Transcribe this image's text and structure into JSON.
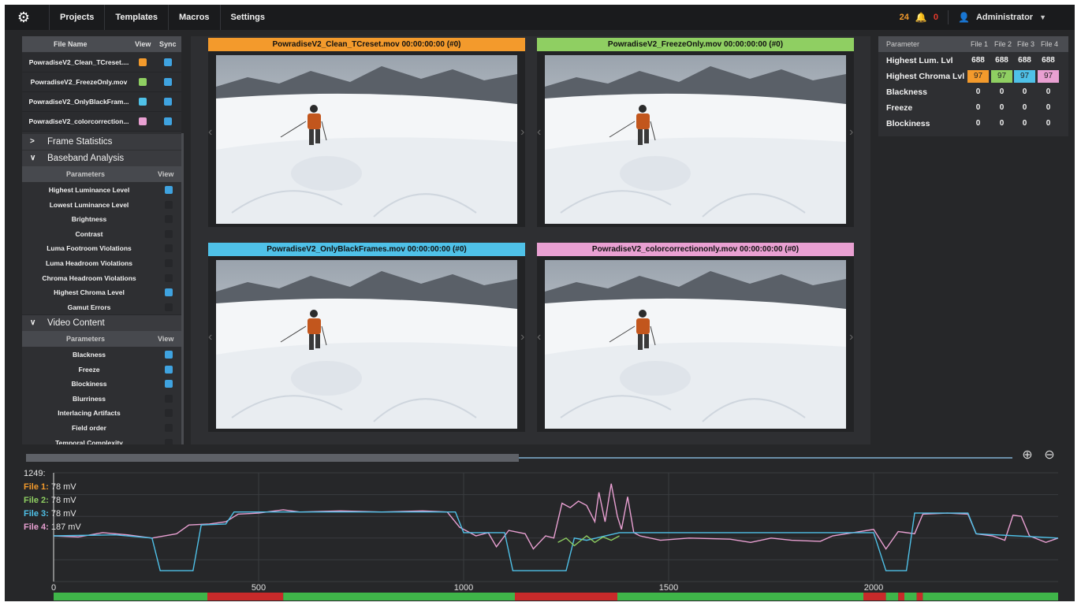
{
  "nav": {
    "items": [
      "Projects",
      "Templates",
      "Macros",
      "Settings"
    ]
  },
  "status": {
    "warnings": "24",
    "alerts": "0",
    "user": "Administrator"
  },
  "files": {
    "headers": {
      "name": "File Name",
      "view": "View",
      "sync": "Sync"
    },
    "rows": [
      {
        "name": "PowradiseV2_Clean_TCreset....",
        "color": "#f39a2c"
      },
      {
        "name": "PowradiseV2_FreezeOnly.mov",
        "color": "#8fcf62"
      },
      {
        "name": "PowradiseV2_OnlyBlackFram...",
        "color": "#4fc1e8"
      },
      {
        "name": "PowradiseV2_colorcorrection...",
        "color": "#e9a0d2"
      }
    ]
  },
  "sections": {
    "frame_stats": "Frame Statistics",
    "baseband": "Baseband Analysis",
    "video": "Video Content"
  },
  "params_headers": {
    "parameters": "Parameters",
    "view": "View"
  },
  "baseband_params": [
    {
      "name": "Highest Luminance Level",
      "on": true
    },
    {
      "name": "Lowest Luminance Level",
      "on": false
    },
    {
      "name": "Brightness",
      "on": false
    },
    {
      "name": "Contrast",
      "on": false
    },
    {
      "name": "Luma Footroom Violations",
      "on": false
    },
    {
      "name": "Luma Headroom Violations",
      "on": false
    },
    {
      "name": "Chroma Headroom Violations",
      "on": false
    },
    {
      "name": "Highest Chroma Level",
      "on": true
    },
    {
      "name": "Gamut Errors",
      "on": false
    }
  ],
  "video_params": [
    {
      "name": "Blackness",
      "on": true
    },
    {
      "name": "Freeze",
      "on": true
    },
    {
      "name": "Blockiness",
      "on": true
    },
    {
      "name": "Blurriness",
      "on": false
    },
    {
      "name": "Interlacing Artifacts",
      "on": false
    },
    {
      "name": "Field order",
      "on": false
    },
    {
      "name": "Temporal Complexity",
      "on": false
    }
  ],
  "videos": [
    {
      "title": "PowradiseV2_Clean_TCreset.mov 00:00:00:00 (#0)",
      "color": "#f39a2c"
    },
    {
      "title": "PowradiseV2_FreezeOnly.mov 00:00:00:00 (#0)",
      "color": "#8fcf62"
    },
    {
      "title": "PowradiseV2_OnlyBlackFrames.mov 00:00:00:00 (#0)",
      "color": "#4fc1e8"
    },
    {
      "title": "PowradiseV2_colorcorrectiononly.mov 00:00:00:00 (#0)",
      "color": "#e9a0d2"
    }
  ],
  "stats": {
    "headers": [
      "Parameter",
      "File 1",
      "File 2",
      "File 3",
      "File 4"
    ],
    "rows": [
      {
        "label": "Highest Lum. Lvl",
        "values": [
          "688",
          "688",
          "688",
          "688"
        ]
      },
      {
        "label": "Highest Chroma Lvl",
        "values": [
          "97",
          "97",
          "97",
          "97"
        ]
      },
      {
        "label": "Blackness",
        "values": [
          "0",
          "0",
          "0",
          "0"
        ]
      },
      {
        "label": "Freeze",
        "values": [
          "0",
          "0",
          "0",
          "0"
        ]
      },
      {
        "label": "Blockiness",
        "values": [
          "0",
          "0",
          "0",
          "0"
        ]
      }
    ]
  },
  "readout": {
    "frame": "1249:",
    "lines": [
      {
        "label": "File 1:",
        "value": "78 mV",
        "color": "#f39a2c"
      },
      {
        "label": "File 2:",
        "value": "78 mV",
        "color": "#8fcf62"
      },
      {
        "label": "File 3:",
        "value": "78 mV",
        "color": "#4fc1e8"
      },
      {
        "label": "File 4:",
        "value": "187 mV",
        "color": "#e9a0d2"
      }
    ]
  },
  "chart_data": {
    "type": "line",
    "x_ticks": [
      "0",
      "500",
      "1000",
      "1500",
      "2000"
    ],
    "xlim": [
      0,
      2450
    ],
    "ylim": [
      0,
      1
    ],
    "series": [
      {
        "name": "File 4",
        "color": "#e9a0d2",
        "points": [
          [
            0,
            0.42
          ],
          [
            60,
            0.41
          ],
          [
            120,
            0.45
          ],
          [
            180,
            0.43
          ],
          [
            240,
            0.4
          ],
          [
            300,
            0.44
          ],
          [
            330,
            0.52
          ],
          [
            380,
            0.53
          ],
          [
            420,
            0.55
          ],
          [
            450,
            0.62
          ],
          [
            500,
            0.63
          ],
          [
            520,
            0.64
          ],
          [
            560,
            0.66
          ],
          [
            600,
            0.64
          ],
          [
            700,
            0.65
          ],
          [
            800,
            0.64
          ],
          [
            900,
            0.65
          ],
          [
            960,
            0.64
          ],
          [
            990,
            0.5
          ],
          [
            1030,
            0.42
          ],
          [
            1060,
            0.45
          ],
          [
            1080,
            0.32
          ],
          [
            1110,
            0.47
          ],
          [
            1150,
            0.44
          ],
          [
            1170,
            0.3
          ],
          [
            1200,
            0.42
          ],
          [
            1220,
            0.4
          ],
          [
            1240,
            0.72
          ],
          [
            1260,
            0.68
          ],
          [
            1280,
            0.74
          ],
          [
            1300,
            0.7
          ],
          [
            1320,
            0.55
          ],
          [
            1330,
            0.82
          ],
          [
            1345,
            0.55
          ],
          [
            1360,
            0.9
          ],
          [
            1375,
            0.6
          ],
          [
            1385,
            0.48
          ],
          [
            1400,
            0.78
          ],
          [
            1415,
            0.45
          ],
          [
            1430,
            0.42
          ],
          [
            1480,
            0.38
          ],
          [
            1550,
            0.4
          ],
          [
            1650,
            0.39
          ],
          [
            1700,
            0.36
          ],
          [
            1750,
            0.4
          ],
          [
            1800,
            0.38
          ],
          [
            1870,
            0.37
          ],
          [
            1900,
            0.42
          ],
          [
            1950,
            0.45
          ],
          [
            2000,
            0.48
          ],
          [
            2030,
            0.3
          ],
          [
            2060,
            0.46
          ],
          [
            2100,
            0.44
          ],
          [
            2120,
            0.62
          ],
          [
            2180,
            0.63
          ],
          [
            2230,
            0.62
          ],
          [
            2250,
            0.44
          ],
          [
            2290,
            0.42
          ],
          [
            2320,
            0.38
          ],
          [
            2340,
            0.61
          ],
          [
            2360,
            0.6
          ],
          [
            2380,
            0.42
          ],
          [
            2420,
            0.36
          ],
          [
            2450,
            0.4
          ]
        ]
      },
      {
        "name": "File 3",
        "color": "#4fc1e8",
        "points": [
          [
            0,
            0.42
          ],
          [
            150,
            0.43
          ],
          [
            240,
            0.4
          ],
          [
            260,
            0.1
          ],
          [
            340,
            0.1
          ],
          [
            360,
            0.52
          ],
          [
            420,
            0.53
          ],
          [
            440,
            0.64
          ],
          [
            980,
            0.64
          ],
          [
            1000,
            0.45
          ],
          [
            1100,
            0.45
          ],
          [
            1120,
            0.1
          ],
          [
            1250,
            0.1
          ],
          [
            1270,
            0.4
          ],
          [
            1300,
            0.38
          ],
          [
            1380,
            0.45
          ],
          [
            2000,
            0.45
          ],
          [
            2030,
            0.1
          ],
          [
            2080,
            0.1
          ],
          [
            2100,
            0.63
          ],
          [
            2230,
            0.63
          ],
          [
            2250,
            0.44
          ],
          [
            2450,
            0.4
          ]
        ]
      },
      {
        "name": "File 2",
        "color": "#8fcf62",
        "points": [
          [
            1230,
            0.36
          ],
          [
            1250,
            0.4
          ],
          [
            1270,
            0.33
          ],
          [
            1300,
            0.42
          ],
          [
            1320,
            0.36
          ],
          [
            1340,
            0.41
          ],
          [
            1360,
            0.38
          ],
          [
            1380,
            0.42
          ]
        ]
      }
    ],
    "segments": [
      {
        "start": 0,
        "end": 375,
        "state": "ok"
      },
      {
        "start": 375,
        "end": 560,
        "state": "error"
      },
      {
        "start": 560,
        "end": 1125,
        "state": "ok"
      },
      {
        "start": 1125,
        "end": 1375,
        "state": "error"
      },
      {
        "start": 1375,
        "end": 1975,
        "state": "ok"
      },
      {
        "start": 1975,
        "end": 2030,
        "state": "error"
      },
      {
        "start": 2030,
        "end": 2060,
        "state": "ok"
      },
      {
        "start": 2060,
        "end": 2075,
        "state": "error"
      },
      {
        "start": 2075,
        "end": 2105,
        "state": "ok"
      },
      {
        "start": 2105,
        "end": 2120,
        "state": "error"
      },
      {
        "start": 2120,
        "end": 2450,
        "state": "ok"
      }
    ],
    "segment_colors": {
      "ok": "#3fb549",
      "error": "#c72a2a"
    }
  }
}
